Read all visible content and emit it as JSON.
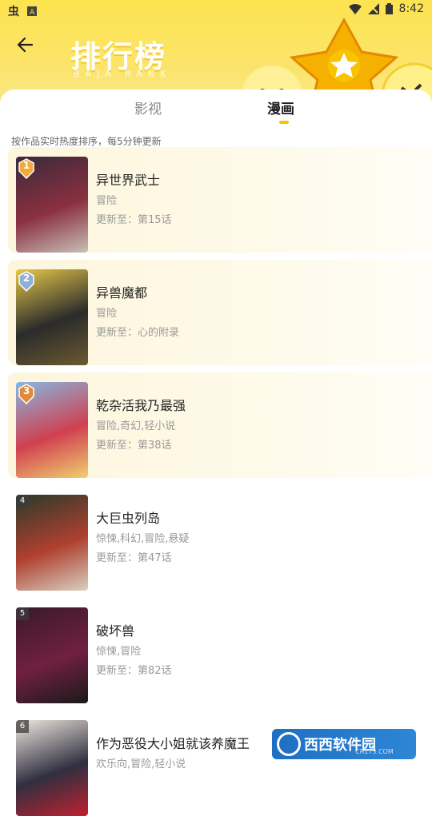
{
  "status_bar": {
    "time": "8:42"
  },
  "header": {
    "title": "排行榜",
    "subtitle": "BAJA RANK"
  },
  "tabs": [
    {
      "label": "影视",
      "active": false
    },
    {
      "label": "漫画",
      "active": true
    }
  ],
  "note": "按作品实时热度排序，每5分钟更新",
  "items": [
    {
      "rank": "1",
      "title": "异世界武士",
      "genres": "冒险",
      "update": "更新至：第15话",
      "top": true,
      "cover_colors": [
        "#3a2a3a",
        "#8a3040",
        "#c8c0b8"
      ]
    },
    {
      "rank": "2",
      "title": "异兽魔都",
      "genres": "冒险",
      "update": "更新至：心的附录",
      "top": true,
      "cover_colors": [
        "#e6c84a",
        "#2b2b2b",
        "#6a5a30"
      ]
    },
    {
      "rank": "3",
      "title": "乾杂活我乃最强",
      "genres": "冒险,奇幻,轻小说",
      "update": "更新至：第38话",
      "top": true,
      "cover_colors": [
        "#86b8e0",
        "#d04050",
        "#f0d070"
      ]
    },
    {
      "rank": "4",
      "title": "大巨虫列岛",
      "genres": "惊悚,科幻,冒险,悬疑",
      "update": "更新至：第47话",
      "top": false,
      "cover_colors": [
        "#2a3a2a",
        "#b04030",
        "#d8d0c0"
      ]
    },
    {
      "rank": "5",
      "title": "破坏兽",
      "genres": "惊悚,冒险",
      "update": "更新至：第82话",
      "top": false,
      "cover_colors": [
        "#3a1a2a",
        "#702040",
        "#1a1a1a"
      ]
    },
    {
      "rank": "6",
      "title": "作为恶役大小姐就该养魔王",
      "genres": "欢乐向,冒险,轻小说",
      "update": "",
      "top": false,
      "cover_colors": [
        "#f0e8e0",
        "#303040",
        "#c02030"
      ]
    }
  ],
  "watermark": {
    "text": "西西软件园",
    "sub": "CR173.COM"
  },
  "colors": {
    "accent": "#f7c600",
    "header_bg": "#fde34f"
  }
}
